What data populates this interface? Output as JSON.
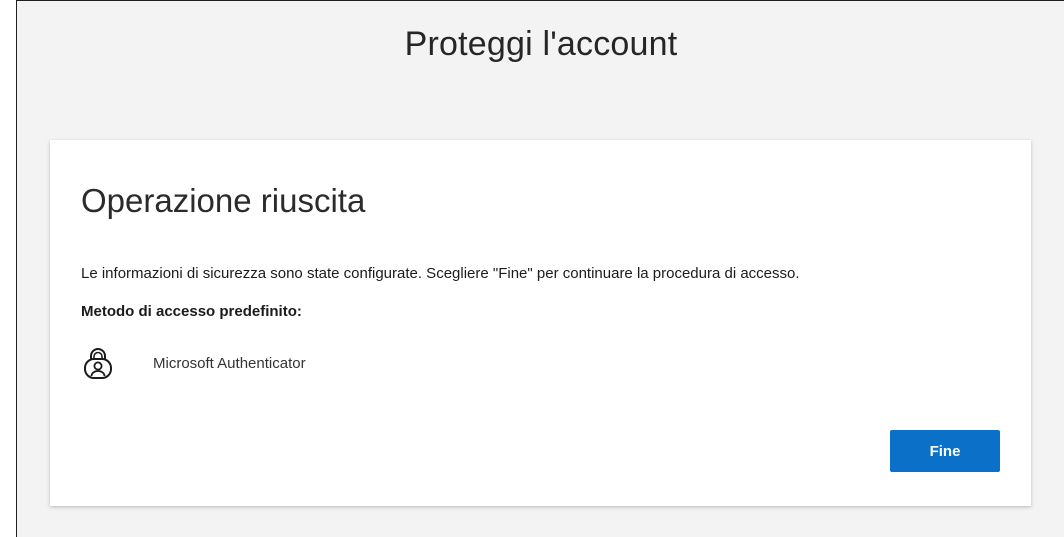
{
  "page": {
    "title": "Proteggi l'account"
  },
  "card": {
    "heading": "Operazione riuscita",
    "info": "Le informazioni di sicurezza sono state configurate. Scegliere \"Fine\" per continuare la procedura di accesso.",
    "method_label": "Metodo di accesso predefinito:",
    "method": {
      "icon": "authenticator-lock-icon",
      "name": "Microsoft Authenticator"
    },
    "done_label": "Fine"
  },
  "colors": {
    "background": "#f3f3f3",
    "card": "#ffffff",
    "primary_button": "#0a70c8"
  }
}
